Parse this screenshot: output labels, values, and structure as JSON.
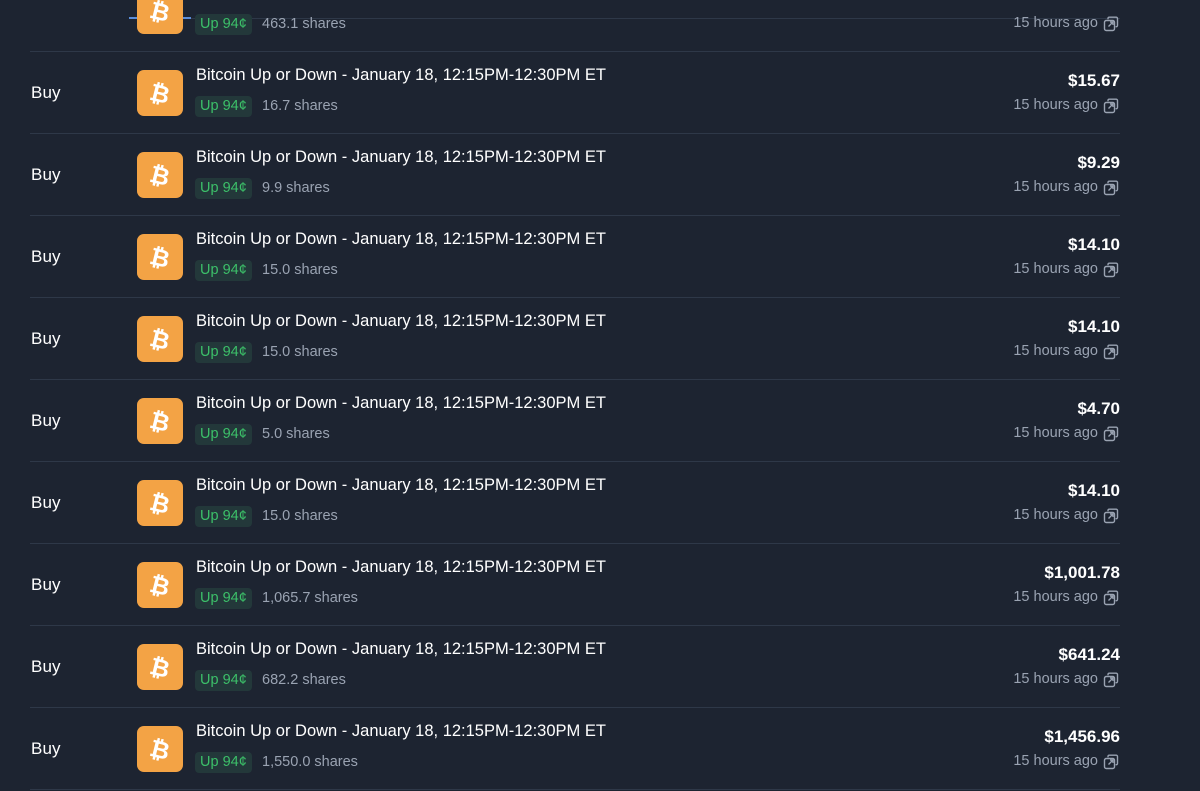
{
  "colors": {
    "background": "#1d2431",
    "icon_bg": "#f3a345",
    "badge_bg": "#23383a",
    "badge_text": "#3cc069",
    "muted_text": "#9aa3b2"
  },
  "icons": {
    "market": "bitcoin-icon",
    "link": "external-link-icon"
  },
  "activity": {
    "rows": [
      {
        "type": "",
        "title": "",
        "outcome": "Up 94¢",
        "shares": "463.1 shares",
        "amount": "",
        "time": "15 hours ago"
      },
      {
        "type": "Buy",
        "title": "Bitcoin Up or Down - January 18, 12:15PM-12:30PM ET",
        "outcome": "Up 94¢",
        "shares": "16.7 shares",
        "amount": "$15.67",
        "time": "15 hours ago"
      },
      {
        "type": "Buy",
        "title": "Bitcoin Up or Down - January 18, 12:15PM-12:30PM ET",
        "outcome": "Up 94¢",
        "shares": "9.9 shares",
        "amount": "$9.29",
        "time": "15 hours ago"
      },
      {
        "type": "Buy",
        "title": "Bitcoin Up or Down - January 18, 12:15PM-12:30PM ET",
        "outcome": "Up 94¢",
        "shares": "15.0 shares",
        "amount": "$14.10",
        "time": "15 hours ago"
      },
      {
        "type": "Buy",
        "title": "Bitcoin Up or Down - January 18, 12:15PM-12:30PM ET",
        "outcome": "Up 94¢",
        "shares": "15.0 shares",
        "amount": "$14.10",
        "time": "15 hours ago"
      },
      {
        "type": "Buy",
        "title": "Bitcoin Up or Down - January 18, 12:15PM-12:30PM ET",
        "outcome": "Up 94¢",
        "shares": "5.0 shares",
        "amount": "$4.70",
        "time": "15 hours ago"
      },
      {
        "type": "Buy",
        "title": "Bitcoin Up or Down - January 18, 12:15PM-12:30PM ET",
        "outcome": "Up 94¢",
        "shares": "15.0 shares",
        "amount": "$14.10",
        "time": "15 hours ago"
      },
      {
        "type": "Buy",
        "title": "Bitcoin Up or Down - January 18, 12:15PM-12:30PM ET",
        "outcome": "Up 94¢",
        "shares": "1,065.7 shares",
        "amount": "$1,001.78",
        "time": "15 hours ago"
      },
      {
        "type": "Buy",
        "title": "Bitcoin Up or Down - January 18, 12:15PM-12:30PM ET",
        "outcome": "Up 94¢",
        "shares": "682.2 shares",
        "amount": "$641.24",
        "time": "15 hours ago"
      },
      {
        "type": "Buy",
        "title": "Bitcoin Up or Down - January 18, 12:15PM-12:30PM ET",
        "outcome": "Up 94¢",
        "shares": "1,550.0 shares",
        "amount": "$1,456.96",
        "time": "15 hours ago"
      }
    ]
  }
}
